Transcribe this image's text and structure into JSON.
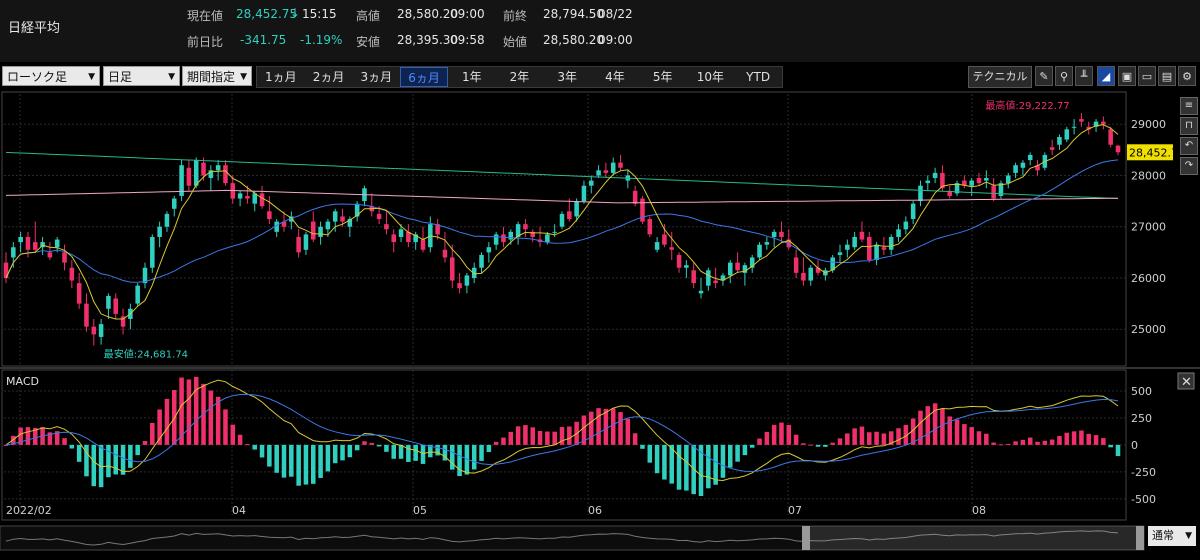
{
  "header": {
    "title": "日経平均",
    "current_label": "現在値",
    "current_value": "28,452.75",
    "current_arrow": "↓",
    "current_time": "15:15",
    "change_label": "前日比",
    "change_value": "-341.75",
    "change_pct": "-1.19%",
    "high_label": "高値",
    "high_value": "28,580.20",
    "high_time": "09:00",
    "low_label": "安値",
    "low_value": "28,395.30",
    "low_time": "09:58",
    "prev_label": "前終",
    "prev_value": "28,794.50",
    "prev_date": "08/22",
    "open_label": "始値",
    "open_value": "28,580.20",
    "open_time": "09:00"
  },
  "toolbar": {
    "chart_type": "ローソク足",
    "interval": "日足",
    "period_mode": "期間指定",
    "tabs": [
      "1ヵ月",
      "2ヵ月",
      "3ヵ月",
      "6ヵ月",
      "1年",
      "2年",
      "3年",
      "4年",
      "5年",
      "10年",
      "YTD"
    ],
    "active_tab": "6ヵ月",
    "technical_label": "テクニカル"
  },
  "bottom": {
    "mode": "通常"
  },
  "colors": {
    "up": "#2fd0c0",
    "down": "#f0306a",
    "ma_short": "#d8c832",
    "ma_mid": "#3a78e8",
    "ma_long": "#f0a8c8",
    "ma_vlong": "#28b890",
    "macd_line": "#d8c832",
    "signal_line": "#3a78e8",
    "price_tag": "#f0e000"
  },
  "chart_data": [
    {
      "type": "candlestick",
      "title": "",
      "y_ticks": [
        25000,
        26000,
        27000,
        28000,
        29000
      ],
      "ylim": [
        24400,
        29550
      ],
      "x_tick_labels": [
        "2022/02",
        "04",
        "05",
        "06",
        "07",
        "08"
      ],
      "last_price_tag": "28,452.75",
      "annotations": {
        "max": "最高値:29,222.77",
        "min": "最安値:24,681.74"
      },
      "grid": true,
      "candles_ohlc": [
        [
          26300,
          26500,
          25900,
          26000
        ],
        [
          26400,
          26700,
          26200,
          26600
        ],
        [
          26700,
          26900,
          26500,
          26800
        ],
        [
          26800,
          26900,
          26400,
          26550
        ],
        [
          26700,
          27100,
          26500,
          26550
        ],
        [
          26600,
          26800,
          26450,
          26700
        ],
        [
          26500,
          26700,
          26350,
          26400
        ],
        [
          26600,
          26800,
          26500,
          26750
        ],
        [
          26500,
          26650,
          26150,
          26300
        ],
        [
          26200,
          26350,
          25800,
          25950
        ],
        [
          25900,
          26100,
          25400,
          25500
        ],
        [
          25500,
          25700,
          24950,
          25050
        ],
        [
          25050,
          25200,
          24681,
          24900
        ],
        [
          24850,
          25200,
          24700,
          25100
        ],
        [
          25400,
          25700,
          25200,
          25650
        ],
        [
          25600,
          25700,
          25200,
          25300
        ],
        [
          25250,
          25400,
          24900,
          25050
        ],
        [
          25200,
          25500,
          25000,
          25400
        ],
        [
          25500,
          25900,
          25450,
          25850
        ],
        [
          25900,
          26300,
          25800,
          26200
        ],
        [
          26200,
          26850,
          26100,
          26800
        ],
        [
          26800,
          27100,
          26600,
          27000
        ],
        [
          27000,
          27300,
          26900,
          27250
        ],
        [
          27350,
          27600,
          27200,
          27550
        ],
        [
          27600,
          28300,
          27500,
          28200
        ],
        [
          28150,
          28300,
          27700,
          27800
        ],
        [
          27800,
          28350,
          27750,
          28300
        ],
        [
          28250,
          28350,
          27900,
          28000
        ],
        [
          27950,
          28200,
          27700,
          28100
        ],
        [
          28100,
          28300,
          27900,
          28200
        ],
        [
          28200,
          28300,
          27800,
          27850
        ],
        [
          27850,
          28000,
          27450,
          27550
        ],
        [
          27550,
          27700,
          27400,
          27650
        ],
        [
          27600,
          27800,
          27450,
          27550
        ],
        [
          27450,
          27700,
          27300,
          27650
        ],
        [
          27650,
          27800,
          27350,
          27400
        ],
        [
          27300,
          27600,
          27050,
          27150
        ],
        [
          26900,
          27150,
          26800,
          27100
        ],
        [
          27100,
          27300,
          26900,
          27000
        ],
        [
          27100,
          27300,
          26950,
          27200
        ],
        [
          26800,
          26950,
          26400,
          26500
        ],
        [
          26550,
          26900,
          26450,
          26850
        ],
        [
          27100,
          27300,
          26700,
          26750
        ],
        [
          26800,
          27100,
          26650,
          27000
        ],
        [
          26950,
          27150,
          26800,
          27100
        ],
        [
          27100,
          27350,
          26900,
          27300
        ],
        [
          27200,
          27350,
          27000,
          27100
        ],
        [
          27000,
          27200,
          26800,
          27150
        ],
        [
          27200,
          27500,
          27100,
          27450
        ],
        [
          27500,
          27800,
          27400,
          27750
        ],
        [
          27400,
          27650,
          27200,
          27300
        ],
        [
          27250,
          27400,
          27050,
          27150
        ],
        [
          27050,
          27300,
          26850,
          26950
        ],
        [
          26850,
          26950,
          26500,
          26700
        ],
        [
          26800,
          27050,
          26700,
          26950
        ],
        [
          26900,
          27050,
          26600,
          26700
        ],
        [
          26700,
          26900,
          26550,
          26850
        ],
        [
          26750,
          27000,
          26500,
          26550
        ],
        [
          26600,
          27200,
          26500,
          27050
        ],
        [
          27050,
          27150,
          26750,
          26850
        ],
        [
          26550,
          26900,
          26300,
          26400
        ],
        [
          26400,
          26650,
          25800,
          25950
        ],
        [
          25900,
          26100,
          25700,
          25800
        ],
        [
          25850,
          26100,
          25700,
          26050
        ],
        [
          26000,
          26300,
          25900,
          26200
        ],
        [
          26200,
          26500,
          26100,
          26450
        ],
        [
          26500,
          26700,
          26300,
          26600
        ],
        [
          26650,
          26900,
          26550,
          26850
        ],
        [
          26850,
          27000,
          26600,
          26700
        ],
        [
          26750,
          26950,
          26650,
          26900
        ],
        [
          26800,
          27100,
          26650,
          27050
        ],
        [
          27050,
          27150,
          26800,
          26950
        ],
        [
          26900,
          26950,
          26700,
          26800
        ],
        [
          26750,
          27000,
          26600,
          26700
        ],
        [
          26700,
          26900,
          26650,
          26850
        ],
        [
          26900,
          27050,
          26800,
          26900
        ],
        [
          27000,
          27300,
          26950,
          27250
        ],
        [
          27300,
          27550,
          27100,
          27150
        ],
        [
          27200,
          27550,
          27100,
          27500
        ],
        [
          27500,
          27900,
          27450,
          27800
        ],
        [
          27800,
          28000,
          27650,
          27900
        ],
        [
          28000,
          28200,
          27950,
          28100
        ],
        [
          28100,
          28250,
          27950,
          28050
        ],
        [
          28050,
          28350,
          28000,
          28250
        ],
        [
          28250,
          28400,
          28100,
          28150
        ],
        [
          27900,
          28100,
          27750,
          28000
        ],
        [
          27700,
          27800,
          27400,
          27450
        ],
        [
          27550,
          27600,
          27050,
          27100
        ],
        [
          27150,
          27200,
          26800,
          26850
        ],
        [
          26550,
          26800,
          26500,
          26700
        ],
        [
          26850,
          27050,
          26600,
          26650
        ],
        [
          26600,
          26900,
          26350,
          26550
        ],
        [
          26450,
          26500,
          26100,
          26200
        ],
        [
          26200,
          26350,
          26000,
          26250
        ],
        [
          26150,
          26300,
          25800,
          25900
        ],
        [
          25700,
          26000,
          25600,
          25750
        ],
        [
          25850,
          26200,
          25750,
          26150
        ],
        [
          25950,
          26200,
          25800,
          25900
        ],
        [
          25950,
          26100,
          25850,
          26050
        ],
        [
          26050,
          26350,
          25900,
          26300
        ],
        [
          26300,
          26500,
          26100,
          26150
        ],
        [
          26100,
          26300,
          25850,
          26250
        ],
        [
          26200,
          26450,
          26100,
          26400
        ],
        [
          26400,
          26700,
          26350,
          26650
        ],
        [
          26650,
          26800,
          26550,
          26700
        ],
        [
          26800,
          26950,
          26600,
          26900
        ],
        [
          26900,
          27100,
          26700,
          26800
        ],
        [
          26750,
          26950,
          26550,
          26600
        ],
        [
          26400,
          26550,
          26000,
          26100
        ],
        [
          26100,
          26400,
          25850,
          25950
        ],
        [
          25950,
          26250,
          25850,
          26200
        ],
        [
          26200,
          26350,
          26050,
          26100
        ],
        [
          26050,
          26200,
          25950,
          26150
        ],
        [
          26150,
          26450,
          26100,
          26400
        ],
        [
          26450,
          26650,
          26300,
          26500
        ],
        [
          26550,
          26750,
          26400,
          26650
        ],
        [
          26600,
          26900,
          26550,
          26800
        ],
        [
          26900,
          27100,
          26700,
          26750
        ],
        [
          26800,
          26900,
          26300,
          26350
        ],
        [
          26350,
          26700,
          26250,
          26650
        ],
        [
          26600,
          26800,
          26450,
          26550
        ],
        [
          26550,
          26850,
          26450,
          26800
        ],
        [
          26800,
          27050,
          26700,
          26950
        ],
        [
          26950,
          27200,
          26850,
          27100
        ],
        [
          27150,
          27500,
          27050,
          27450
        ],
        [
          27500,
          27900,
          27400,
          27800
        ],
        [
          27850,
          28000,
          27700,
          27900
        ],
        [
          27950,
          28150,
          27850,
          28050
        ],
        [
          28050,
          28200,
          27700,
          27750
        ],
        [
          27700,
          27800,
          27550,
          27600
        ],
        [
          27650,
          27900,
          27600,
          27850
        ],
        [
          27900,
          28000,
          27750,
          27800
        ],
        [
          27800,
          27950,
          27600,
          27900
        ],
        [
          27950,
          28050,
          27800,
          27850
        ],
        [
          27900,
          28100,
          27750,
          27950
        ],
        [
          27800,
          27950,
          27500,
          27550
        ],
        [
          27600,
          27900,
          27550,
          27850
        ],
        [
          27850,
          28050,
          27750,
          28000
        ],
        [
          28050,
          28250,
          27950,
          28200
        ],
        [
          28150,
          28300,
          28000,
          28250
        ],
        [
          28300,
          28450,
          28200,
          28400
        ],
        [
          28200,
          28300,
          28000,
          28100
        ],
        [
          28150,
          28450,
          28100,
          28400
        ],
        [
          28550,
          28700,
          28400,
          28500
        ],
        [
          28600,
          28800,
          28500,
          28750
        ],
        [
          28700,
          28950,
          28650,
          28900
        ],
        [
          28950,
          29100,
          28800,
          28950
        ],
        [
          29100,
          29222,
          28950,
          29050
        ],
        [
          28950,
          29050,
          28800,
          28900
        ],
        [
          28950,
          29100,
          28850,
          29050
        ],
        [
          29050,
          29150,
          28900,
          29000
        ],
        [
          28900,
          28950,
          28550,
          28600
        ],
        [
          28580,
          28600,
          28395,
          28452
        ]
      ]
    },
    {
      "type": "bar+line",
      "title": "MACD",
      "y_ticks": [
        -500,
        -250,
        0,
        250,
        500
      ],
      "ylim": [
        -650,
        620
      ],
      "grid": true
    }
  ]
}
